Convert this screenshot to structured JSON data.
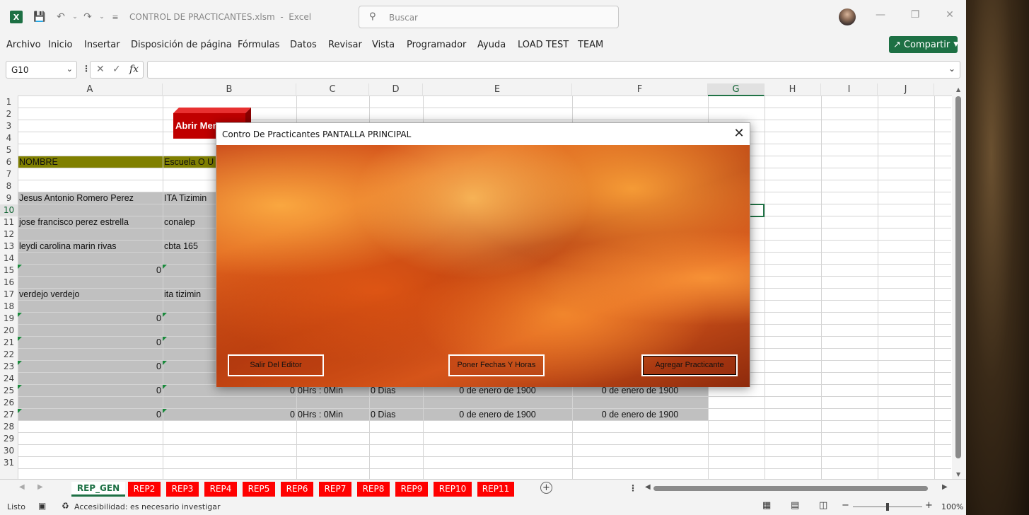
{
  "window": {
    "title": "CONTROL DE PRACTICANTES.xlsm",
    "app": "Excel",
    "separator": "-"
  },
  "search": {
    "placeholder": "Buscar"
  },
  "ribbon": {
    "tabs": [
      "Archivo",
      "Inicio",
      "Insertar",
      "Disposición de página",
      "Fórmulas",
      "Datos",
      "Revisar",
      "Vista",
      "Programador",
      "Ayuda",
      "LOAD TEST",
      "TEAM"
    ],
    "share": "Compartir"
  },
  "formula_bar": {
    "name_box": "G10",
    "fx": "fx",
    "value": ""
  },
  "columns": [
    "A",
    "B",
    "C",
    "D",
    "E",
    "F",
    "G",
    "H",
    "I",
    "J"
  ],
  "selected_column": "G",
  "rows": [
    "1",
    "2",
    "3",
    "4",
    "5",
    "6",
    "7",
    "8",
    "9",
    "10",
    "11",
    "12",
    "13",
    "14",
    "15",
    "16",
    "17",
    "18",
    "19",
    "20",
    "21",
    "22",
    "23",
    "24",
    "25",
    "26",
    "27",
    "28",
    "29",
    "30",
    "31"
  ],
  "selected_row": "10",
  "sheet_button": {
    "label": "Abrir Menu"
  },
  "header_row": {
    "a": "NOMBRE",
    "b": "Escuela O U"
  },
  "cells": {
    "r9a": "Jesus Antonio Romero Perez",
    "r9b": "ITA Tizimin",
    "r11a": "jose francisco perez estrella",
    "r11b": "conalep",
    "r13a": "leydi carolina marin rivas",
    "r13b": "cbta 165",
    "r15a": "0",
    "r17a": "verdejo verdejo",
    "r17b": "ita tizimin",
    "r19a": "0",
    "r21a": "0",
    "r23a": "0",
    "r25a": "0",
    "r25b": "0",
    "r25c": "0Hrs : 0Min",
    "r25d": "0 Dias",
    "r25e": "0 de enero de 1900",
    "r25f": "0 de enero de 1900",
    "r27a": "0",
    "r27b": "0",
    "r27c": "0Hrs : 0Min",
    "r27d": "0 Dias",
    "r27e": "0 de enero de 1900",
    "r27f": "0 de enero de 1900"
  },
  "sheets": [
    "REP_GEN",
    "REP2",
    "REP3",
    "REP4",
    "REP5",
    "REP6",
    "REP7",
    "REP8",
    "REP9",
    "REP10",
    "REP11"
  ],
  "active_sheet": "REP_GEN",
  "status": {
    "ready": "Listo",
    "accessibility": "Accesibilidad: es necesario investigar",
    "zoom": "100%"
  },
  "dialog": {
    "title": "Contro De Practicantes",
    "subtitle": "PANTALLA PRINCIPAL",
    "buttons": {
      "exit": "Salir Del Editor",
      "dates": "Poner Fechas Y Horas",
      "add": "Agregar Practicante"
    }
  },
  "colors": {
    "excel_green": "#1d7044",
    "header_fill": "#808000",
    "row_fill": "#c0c0c0",
    "tab_red": "#ff0000"
  }
}
